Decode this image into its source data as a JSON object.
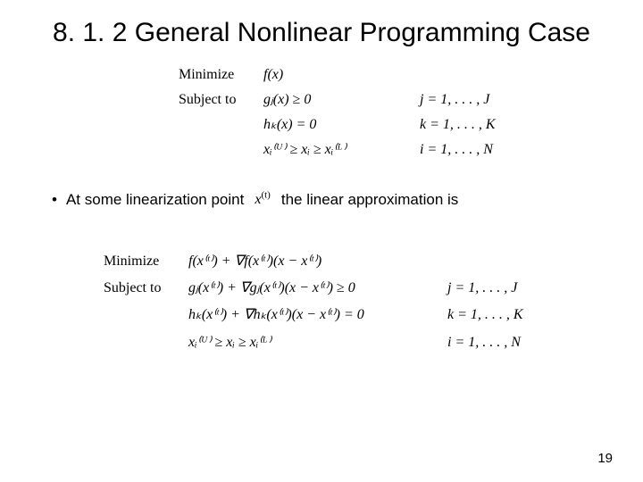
{
  "title": "8. 1. 2 General Nonlinear Programming Case",
  "nlp": {
    "min_label": "Minimize",
    "min_expr": "f(x)",
    "sub_label": "Subject to",
    "g_expr": "gⱼ(x) ≥ 0",
    "g_rng": "j = 1, . . . , J",
    "h_expr": "hₖ(x) = 0",
    "h_rng": "k = 1, . . . , K",
    "b_expr": "xᵢ⁽ᵁ⁾ ≥ xᵢ ≥ xᵢ⁽ᴸ⁾",
    "b_rng": "i = 1, . . . , N"
  },
  "bullet": {
    "pre": "At some linearization point",
    "sym": "x⁽ᵗ⁾",
    "post": "the linear approximation is"
  },
  "lin": {
    "min_label": "Minimize",
    "min_expr": "f(x⁽ᵗ⁾) + ∇f(x⁽ᵗ⁾)(x − x⁽ᵗ⁾)",
    "sub_label": "Subject to",
    "g_expr": "gⱼ(x⁽ᵗ⁾) + ∇gⱼ(x⁽ᵗ⁾)(x − x⁽ᵗ⁾) ≥ 0",
    "g_rng": "j = 1, . . . , J",
    "h_expr": "hₖ(x⁽ᵗ⁾) + ∇hₖ(x⁽ᵗ⁾)(x − x⁽ᵗ⁾) = 0",
    "h_rng": "k = 1, . . . , K",
    "b_expr": "xᵢ⁽ᵁ⁾ ≥ xᵢ ≥ xᵢ⁽ᴸ⁾",
    "b_rng": "i = 1, . . . , N"
  },
  "page": "19"
}
